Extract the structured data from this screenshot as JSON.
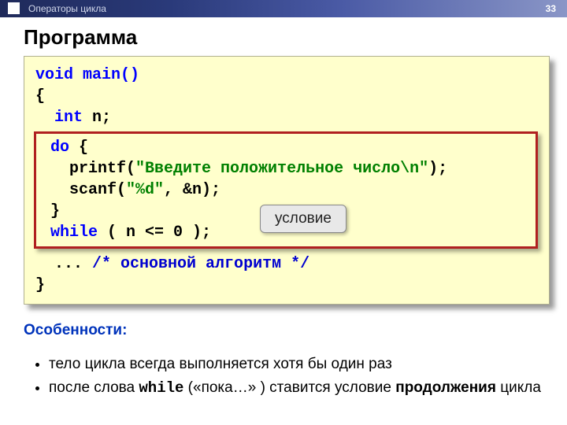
{
  "header": {
    "topic": "Операторы цикла",
    "page_number": "33"
  },
  "title": "Программа",
  "code": {
    "void_main": "void main()",
    "brace_open": "{",
    "int_kw": "int",
    "int_rest": " n;",
    "do_kw": "do",
    "do_brace": " {",
    "printf_name": "printf(",
    "printf_str": "\"Введите положительное число\\n\"",
    "printf_end": ");",
    "scanf_name": "scanf(",
    "scanf_str": "\"%d\"",
    "scanf_end": ", &n);",
    "inner_brace_close": "}",
    "while_kw": "while",
    "while_cond": " ( n <= 0 );",
    "dots": "... ",
    "comment": "/* основной алгоритм */",
    "brace_close": "}"
  },
  "callout": "условие",
  "features": {
    "heading": "Особенности:",
    "b1": "тело цикла всегда выполняется хотя бы один раз",
    "b2_pre": "после слова ",
    "b2_kw": "while",
    "b2_mid": " («пока…» ) ставится условие ",
    "b2_bold": "продолжения",
    "b2_post": " цикла"
  }
}
